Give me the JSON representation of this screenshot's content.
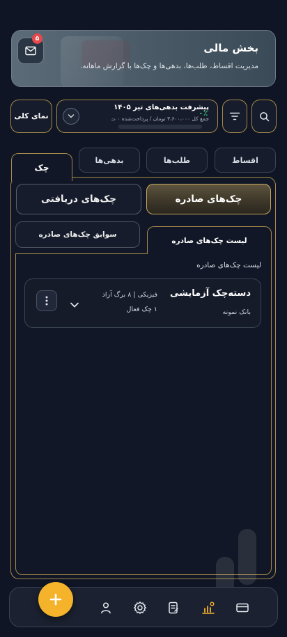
{
  "header": {
    "title": "بخش مالی",
    "description": "مدیریت اقساط، طلب‌ها، بدهی‌ها و چک‌ها با گزارش ماهانه.",
    "notification_count": "۵",
    "mail_icon": "mail-icon"
  },
  "summary": {
    "overview_label": "نمای کلی",
    "progress_title": "پیشرفت بدهی‌های تیر ۱۴۰۵",
    "progress_subtitle": "جمع کل ۳،۶۰۰،۰۰۰ تومان / پرداخت‌شده ۰ ت...",
    "progress_percent": "۰٪",
    "progress_fraction": 0
  },
  "tabs": {
    "items": [
      {
        "label": "اقساط"
      },
      {
        "label": "طلب‌ها"
      },
      {
        "label": "بدهی‌ها"
      },
      {
        "label": "چک"
      }
    ],
    "active": "چک"
  },
  "cheques": {
    "segments": {
      "issued": "چک‌های صادره",
      "received": "چک‌های دریافتی"
    },
    "subtabs": {
      "list": "لیست چک‌های صادره",
      "history": "سوابق چک‌های صادره"
    },
    "list_heading": "لیست چک‌های صادره",
    "items": [
      {
        "title": "دسته‌چک آزمایشی",
        "bank": "بانک نمونه",
        "meta": "فیزیکی | ۸ برگ آزاد",
        "active_count": "۱ چک فعال"
      }
    ]
  },
  "colors": {
    "accent_gold": "#a68a4a",
    "fab_yellow": "#f4b32a",
    "progress_green": "#34d27b",
    "background": "#0f1524"
  },
  "bottom_nav": {
    "icons": [
      "card-icon",
      "chart-icon",
      "document-icon",
      "settings-icon",
      "user-icon"
    ],
    "fab_icon": "plus-icon"
  }
}
